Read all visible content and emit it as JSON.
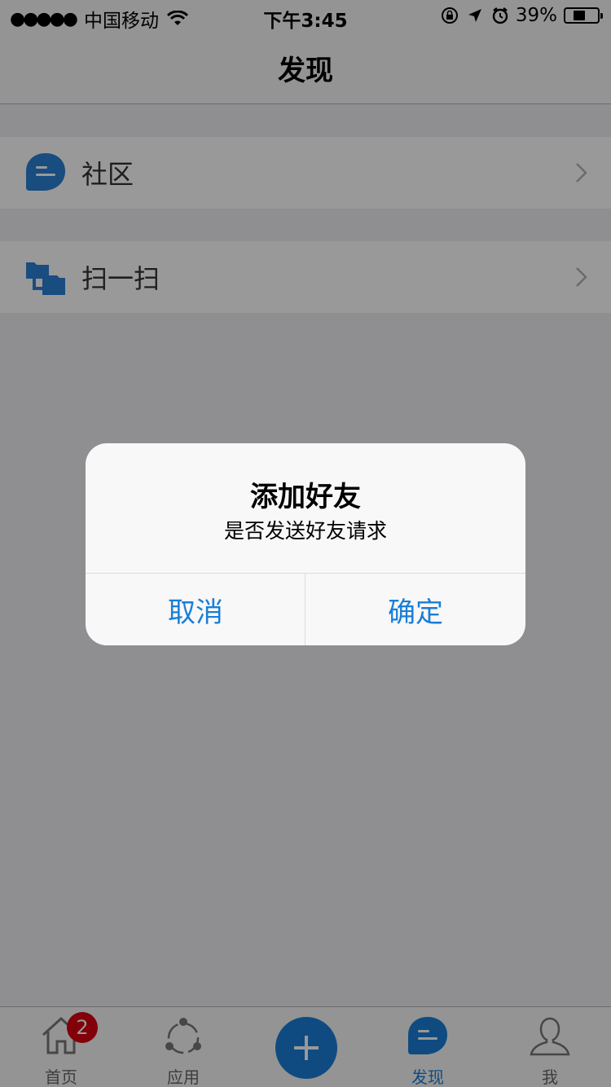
{
  "status_bar": {
    "signal": "●●●●●",
    "carrier": "中国移动",
    "time": "下午3:45",
    "battery": "39%",
    "battery_level": 0.39
  },
  "nav": {
    "title": "发现"
  },
  "list": {
    "items": [
      {
        "label": "社区",
        "icon": "chat-bubble-icon"
      },
      {
        "label": "扫一扫",
        "icon": "scan-icon"
      }
    ]
  },
  "alert": {
    "title": "添加好友",
    "message": "是否发送好友请求",
    "cancel_label": "取消",
    "ok_label": "确定"
  },
  "tab_bar": {
    "tabs": [
      {
        "label": "首页",
        "icon": "home-icon",
        "badge": "2"
      },
      {
        "label": "应用",
        "icon": "apps-icon"
      },
      {
        "label": "",
        "icon": "plus-icon"
      },
      {
        "label": "发现",
        "icon": "discover-icon",
        "active": true
      },
      {
        "label": "我",
        "icon": "profile-icon"
      }
    ]
  },
  "colors": {
    "accent": "#1a7ed6",
    "badge": "#d7000f",
    "overlay": "rgba(0,0,0,0.40)"
  }
}
